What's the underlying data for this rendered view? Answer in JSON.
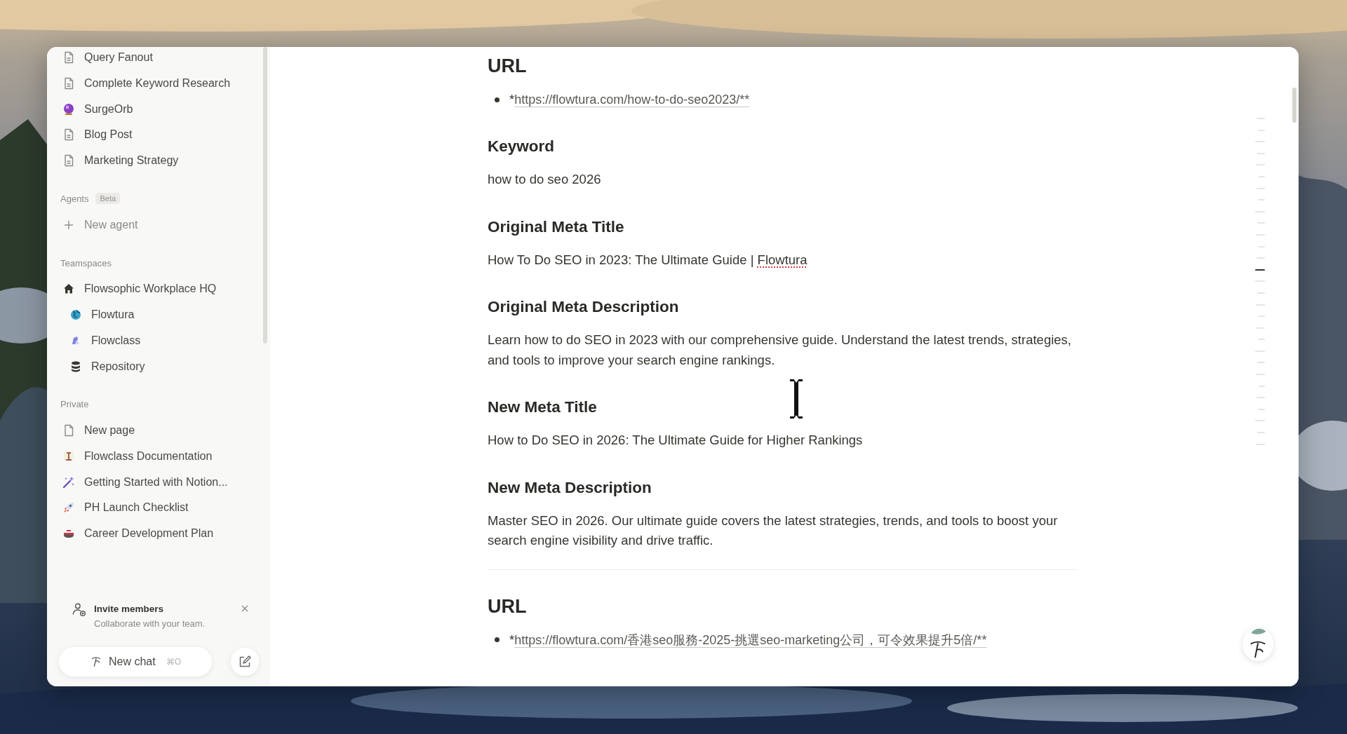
{
  "sidebar": {
    "pages": [
      {
        "label": "Query Fanout",
        "kind": "page"
      },
      {
        "label": "Complete Keyword Research",
        "kind": "page"
      },
      {
        "label": "SurgeOrb",
        "kind": "orb"
      },
      {
        "label": "Blog Post",
        "kind": "page"
      },
      {
        "label": "Marketing Strategy",
        "kind": "page"
      }
    ],
    "agents": {
      "heading": "Agents",
      "badge": "Beta",
      "new_agent": "New agent"
    },
    "teamspaces": {
      "heading": "Teamspaces",
      "items": [
        {
          "label": "Flowsophic Workplace HQ",
          "kind": "home",
          "children": [
            {
              "label": "Flowtura",
              "kind": "globe"
            },
            {
              "label": "Flowclass",
              "kind": "brush"
            },
            {
              "label": "Repository",
              "kind": "database"
            }
          ]
        }
      ]
    },
    "private": {
      "heading": "Private",
      "items": [
        {
          "label": "New page",
          "kind": "blank"
        },
        {
          "label": "Flowclass Documentation",
          "kind": "banner"
        },
        {
          "label": "Getting Started with Notion...",
          "kind": "wand"
        },
        {
          "label": "PH Launch Checklist",
          "kind": "rocket"
        },
        {
          "label": "Career Development Plan",
          "kind": "curling"
        }
      ]
    },
    "invite": {
      "title": "Invite members",
      "subtitle": "Collaborate with your team."
    },
    "new_chat": {
      "label": "New chat",
      "shortcut": "⌘O"
    }
  },
  "document": {
    "blocks": [
      {
        "kind": "heading2",
        "text": "URL"
      },
      {
        "kind": "bullet_link",
        "prefix": "*",
        "link": "https://flowtura.com/how-to-do-seo2023/**"
      },
      {
        "kind": "heading3",
        "text": "Keyword"
      },
      {
        "kind": "paragraph",
        "parts": [
          {
            "text": "how to do seo 2026",
            "misspelled": false
          }
        ]
      },
      {
        "kind": "heading3",
        "text": "Original Meta Title"
      },
      {
        "kind": "paragraph",
        "parts": [
          {
            "text": "How To Do SEO in 2023: The Ultimate Guide | ",
            "misspelled": false
          },
          {
            "text": "Flowtura",
            "misspelled": true
          }
        ]
      },
      {
        "kind": "heading3",
        "text": "Original Meta Description"
      },
      {
        "kind": "paragraph",
        "parts": [
          {
            "text": "Learn how to do SEO in 2023 with our comprehensive guide. Understand the latest trends, strategies, and tools to improve your search engine rankings.",
            "misspelled": false
          }
        ]
      },
      {
        "kind": "heading3",
        "text": "New Meta Title"
      },
      {
        "kind": "paragraph",
        "parts": [
          {
            "text": "How to Do SEO in 2026: The Ultimate Guide for Higher Rankings",
            "misspelled": false
          }
        ]
      },
      {
        "kind": "heading3",
        "text": "New Meta Description"
      },
      {
        "kind": "paragraph",
        "parts": [
          {
            "text": "Master SEO in 2026. Our ultimate guide covers the latest strategies, trends, and tools to boost your search engine visibility and drive traffic.",
            "misspelled": false
          }
        ]
      },
      {
        "kind": "divider"
      },
      {
        "kind": "heading2",
        "text": "URL"
      },
      {
        "kind": "bullet_link",
        "prefix": "*",
        "link": "https://flowtura.com/香港seo服務-2025-挑選seo-marketing公司，可令效果提升5倍/**"
      }
    ]
  },
  "outline": [
    {
      "selected": false
    },
    {
      "selected": false
    },
    {
      "selected": false
    },
    {
      "selected": false
    },
    {
      "selected": false
    },
    {
      "selected": false
    },
    {
      "selected": false
    },
    {
      "selected": false
    },
    {
      "selected": false
    },
    {
      "selected": false
    },
    {
      "selected": false
    },
    {
      "selected": false
    },
    {
      "selected": false
    },
    {
      "selected": true
    },
    {
      "selected": false
    },
    {
      "selected": false
    },
    {
      "selected": false
    },
    {
      "selected": false
    },
    {
      "selected": false
    },
    {
      "selected": false
    },
    {
      "selected": false
    },
    {
      "selected": false
    },
    {
      "selected": false
    },
    {
      "selected": false
    },
    {
      "selected": false
    },
    {
      "selected": false
    },
    {
      "selected": false
    },
    {
      "selected": false
    },
    {
      "selected": false
    }
  ]
}
